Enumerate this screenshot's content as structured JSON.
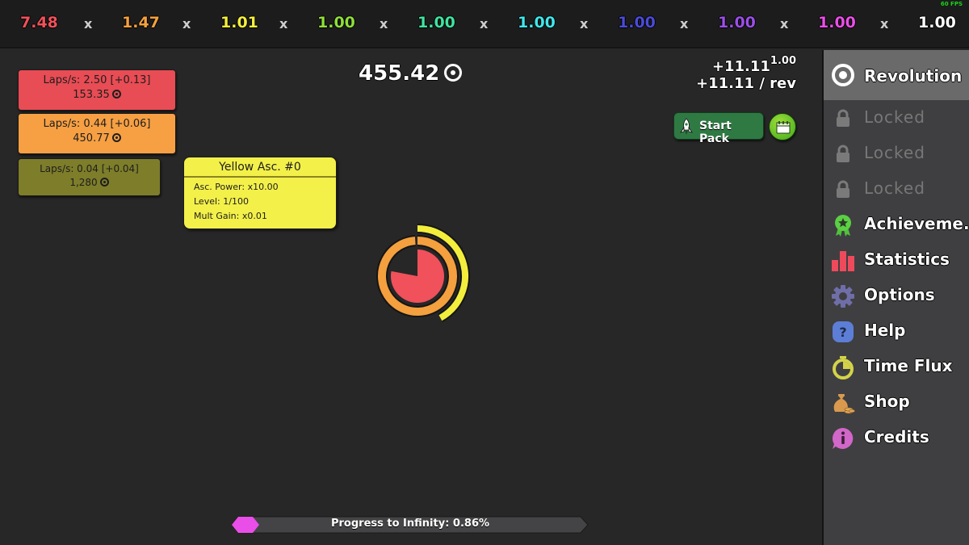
{
  "topbar": {
    "multipliers": [
      {
        "value": "7.48",
        "color": "#f0515a"
      },
      {
        "value": "1.47",
        "color": "#f4a03e"
      },
      {
        "value": "1.01",
        "color": "#f3ee3c"
      },
      {
        "value": "1.00",
        "color": "#8fde3a"
      },
      {
        "value": "1.00",
        "color": "#3fe3a0"
      },
      {
        "value": "1.00",
        "color": "#40e6ea"
      },
      {
        "value": "1.00",
        "color": "#4a4bd8"
      },
      {
        "value": "1.00",
        "color": "#9a4fe8"
      },
      {
        "value": "1.00",
        "color": "#ea4ee8"
      },
      {
        "value": "1.00",
        "color": "#ffffff"
      }
    ],
    "separator": "x",
    "fps": "60 FPS"
  },
  "laps": [
    {
      "rate": "Laps/s: 2.50 [+0.13]",
      "amount": "153.35",
      "color": "#e84c54"
    },
    {
      "rate": "Laps/s: 0.44 [+0.06]",
      "amount": "450.77",
      "color": "#f6a043"
    },
    {
      "rate": "Laps/s: 0.04 [+0.04]",
      "amount": "1,280",
      "color": "#7e7d2a"
    }
  ],
  "ascension": {
    "title": "Yellow Asc. #0",
    "power": "Asc. Power: x10.00",
    "level": "Level: 1/100",
    "mult_gain": "Mult Gain: x0.01"
  },
  "currency": {
    "amount": "455.42"
  },
  "gain": {
    "per_rev_base": "+11.11",
    "exponent": "1.00",
    "per_rev": "+11.11 / rev"
  },
  "start_pack": {
    "label": "Start Pack"
  },
  "rings": {
    "red_fill": 0.78,
    "orange_fill": 0.99,
    "yellow_fill": 0.42,
    "colors": {
      "red": "#f0515a",
      "orange": "#f4a03e",
      "yellow": "#f3ee3c"
    }
  },
  "progress": {
    "label": "Progress to Infinity: 0.86%",
    "percent": 0.86,
    "color": "#e94ee8"
  },
  "sidebar": {
    "items": [
      {
        "label": "Revolution",
        "icon": "revolution-icon",
        "active": true
      },
      {
        "label": "Locked",
        "icon": "lock-icon",
        "locked": true
      },
      {
        "label": "Locked",
        "icon": "lock-icon",
        "locked": true
      },
      {
        "label": "Locked",
        "icon": "lock-icon",
        "locked": true
      },
      {
        "label": "Achieveme...",
        "icon": "achievement-icon"
      },
      {
        "label": "Statistics",
        "icon": "statistics-icon"
      },
      {
        "label": "Options",
        "icon": "gear-icon"
      },
      {
        "label": "Help",
        "icon": "help-icon"
      },
      {
        "label": "Time Flux",
        "icon": "stopwatch-icon"
      },
      {
        "label": "Shop",
        "icon": "money-bag-icon"
      },
      {
        "label": "Credits",
        "icon": "info-icon"
      }
    ]
  }
}
